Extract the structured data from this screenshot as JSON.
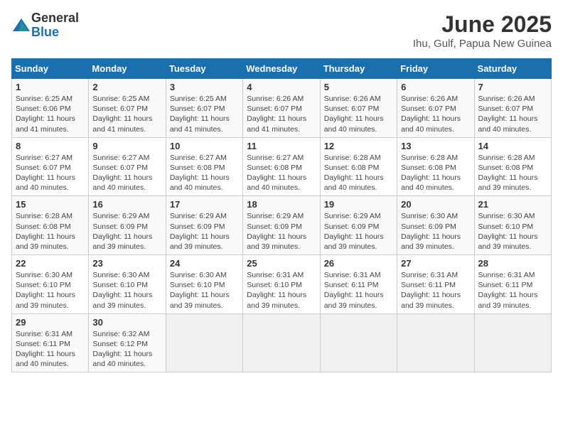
{
  "logo": {
    "text_general": "General",
    "text_blue": "Blue"
  },
  "title": "June 2025",
  "subtitle": "Ihu, Gulf, Papua New Guinea",
  "header_days": [
    "Sunday",
    "Monday",
    "Tuesday",
    "Wednesday",
    "Thursday",
    "Friday",
    "Saturday"
  ],
  "weeks": [
    [
      {
        "day": "1",
        "sunrise": "6:25 AM",
        "sunset": "6:06 PM",
        "daylight": "11 hours and 41 minutes."
      },
      {
        "day": "2",
        "sunrise": "6:25 AM",
        "sunset": "6:07 PM",
        "daylight": "11 hours and 41 minutes."
      },
      {
        "day": "3",
        "sunrise": "6:25 AM",
        "sunset": "6:07 PM",
        "daylight": "11 hours and 41 minutes."
      },
      {
        "day": "4",
        "sunrise": "6:26 AM",
        "sunset": "6:07 PM",
        "daylight": "11 hours and 41 minutes."
      },
      {
        "day": "5",
        "sunrise": "6:26 AM",
        "sunset": "6:07 PM",
        "daylight": "11 hours and 40 minutes."
      },
      {
        "day": "6",
        "sunrise": "6:26 AM",
        "sunset": "6:07 PM",
        "daylight": "11 hours and 40 minutes."
      },
      {
        "day": "7",
        "sunrise": "6:26 AM",
        "sunset": "6:07 PM",
        "daylight": "11 hours and 40 minutes."
      }
    ],
    [
      {
        "day": "8",
        "sunrise": "6:27 AM",
        "sunset": "6:07 PM",
        "daylight": "11 hours and 40 minutes."
      },
      {
        "day": "9",
        "sunrise": "6:27 AM",
        "sunset": "6:07 PM",
        "daylight": "11 hours and 40 minutes."
      },
      {
        "day": "10",
        "sunrise": "6:27 AM",
        "sunset": "6:08 PM",
        "daylight": "11 hours and 40 minutes."
      },
      {
        "day": "11",
        "sunrise": "6:27 AM",
        "sunset": "6:08 PM",
        "daylight": "11 hours and 40 minutes."
      },
      {
        "day": "12",
        "sunrise": "6:28 AM",
        "sunset": "6:08 PM",
        "daylight": "11 hours and 40 minutes."
      },
      {
        "day": "13",
        "sunrise": "6:28 AM",
        "sunset": "6:08 PM",
        "daylight": "11 hours and 40 minutes."
      },
      {
        "day": "14",
        "sunrise": "6:28 AM",
        "sunset": "6:08 PM",
        "daylight": "11 hours and 39 minutes."
      }
    ],
    [
      {
        "day": "15",
        "sunrise": "6:28 AM",
        "sunset": "6:08 PM",
        "daylight": "11 hours and 39 minutes."
      },
      {
        "day": "16",
        "sunrise": "6:29 AM",
        "sunset": "6:09 PM",
        "daylight": "11 hours and 39 minutes."
      },
      {
        "day": "17",
        "sunrise": "6:29 AM",
        "sunset": "6:09 PM",
        "daylight": "11 hours and 39 minutes."
      },
      {
        "day": "18",
        "sunrise": "6:29 AM",
        "sunset": "6:09 PM",
        "daylight": "11 hours and 39 minutes."
      },
      {
        "day": "19",
        "sunrise": "6:29 AM",
        "sunset": "6:09 PM",
        "daylight": "11 hours and 39 minutes."
      },
      {
        "day": "20",
        "sunrise": "6:30 AM",
        "sunset": "6:09 PM",
        "daylight": "11 hours and 39 minutes."
      },
      {
        "day": "21",
        "sunrise": "6:30 AM",
        "sunset": "6:10 PM",
        "daylight": "11 hours and 39 minutes."
      }
    ],
    [
      {
        "day": "22",
        "sunrise": "6:30 AM",
        "sunset": "6:10 PM",
        "daylight": "11 hours and 39 minutes."
      },
      {
        "day": "23",
        "sunrise": "6:30 AM",
        "sunset": "6:10 PM",
        "daylight": "11 hours and 39 minutes."
      },
      {
        "day": "24",
        "sunrise": "6:30 AM",
        "sunset": "6:10 PM",
        "daylight": "11 hours and 39 minutes."
      },
      {
        "day": "25",
        "sunrise": "6:31 AM",
        "sunset": "6:10 PM",
        "daylight": "11 hours and 39 minutes."
      },
      {
        "day": "26",
        "sunrise": "6:31 AM",
        "sunset": "6:11 PM",
        "daylight": "11 hours and 39 minutes."
      },
      {
        "day": "27",
        "sunrise": "6:31 AM",
        "sunset": "6:11 PM",
        "daylight": "11 hours and 39 minutes."
      },
      {
        "day": "28",
        "sunrise": "6:31 AM",
        "sunset": "6:11 PM",
        "daylight": "11 hours and 39 minutes."
      }
    ],
    [
      {
        "day": "29",
        "sunrise": "6:31 AM",
        "sunset": "6:11 PM",
        "daylight": "11 hours and 40 minutes."
      },
      {
        "day": "30",
        "sunrise": "6:32 AM",
        "sunset": "6:12 PM",
        "daylight": "11 hours and 40 minutes."
      },
      null,
      null,
      null,
      null,
      null
    ]
  ]
}
